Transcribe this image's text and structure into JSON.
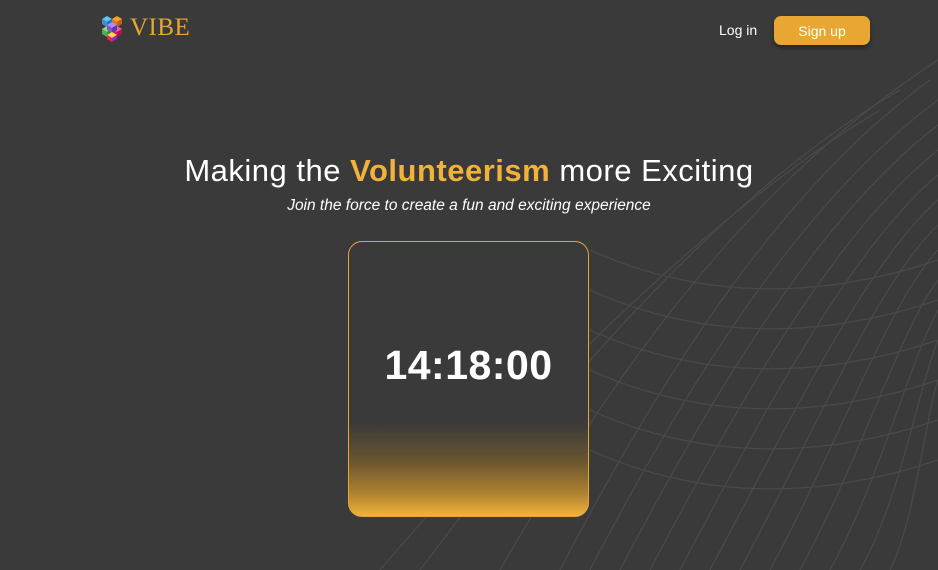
{
  "header": {
    "logo_text": "VIBE",
    "login_label": "Log in",
    "signup_label": "Sign up"
  },
  "hero": {
    "title_before": "Making the ",
    "title_accent": "Volunteerism",
    "title_after": " more Exciting",
    "subtitle": "Join the force to create a fun and exciting experience"
  },
  "timer": {
    "value": "14:18:00"
  },
  "colors": {
    "background": "#3a3a3a",
    "accent": "#e8a733",
    "text": "#ffffff"
  },
  "icons": {
    "logo": "vibe-cube-logo-icon"
  }
}
